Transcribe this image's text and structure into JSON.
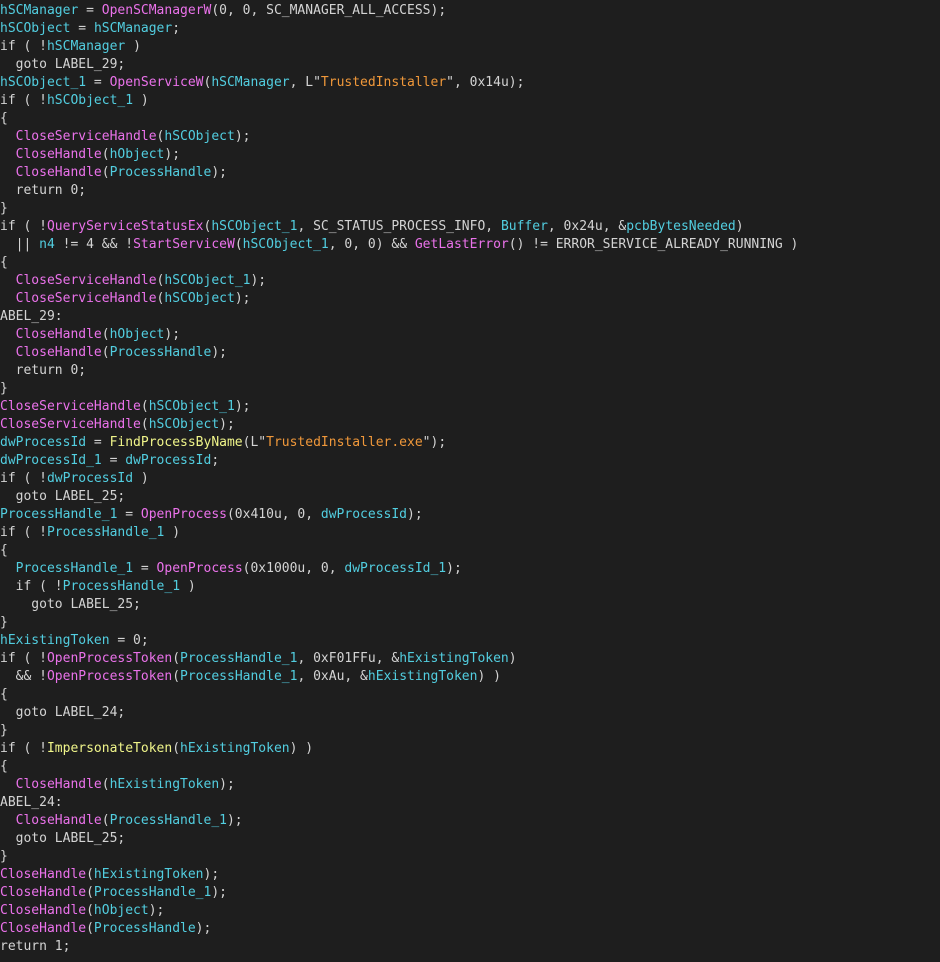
{
  "colors": {
    "background": "#1e1e1e",
    "t": "#d4d4d4",
    "v": "#52cee0",
    "f": "#eb72eb",
    "g": "#f0f58a",
    "s": "#f0983a"
  },
  "code": {
    "lines": [
      [
        [
          "v",
          "hSCManager"
        ],
        [
          "t",
          " = "
        ],
        [
          "f",
          "OpenSCManagerW"
        ],
        [
          "t",
          "(0, 0, SC_MANAGER_ALL_ACCESS);"
        ]
      ],
      [
        [
          "v",
          "hSCObject"
        ],
        [
          "t",
          " = "
        ],
        [
          "v",
          "hSCManager"
        ],
        [
          "t",
          ";"
        ]
      ],
      [
        [
          "t",
          "if ( !"
        ],
        [
          "v",
          "hSCManager"
        ],
        [
          "t",
          " )"
        ]
      ],
      [
        [
          "t",
          "  goto LABEL_29;"
        ]
      ],
      [
        [
          "v",
          "hSCObject_1"
        ],
        [
          "t",
          " = "
        ],
        [
          "f",
          "OpenServiceW"
        ],
        [
          "t",
          "("
        ],
        [
          "v",
          "hSCManager"
        ],
        [
          "t",
          ", L\""
        ],
        [
          "s",
          "TrustedInstaller"
        ],
        [
          "t",
          "\", 0x14u);"
        ]
      ],
      [
        [
          "t",
          "if ( !"
        ],
        [
          "v",
          "hSCObject_1"
        ],
        [
          "t",
          " )"
        ]
      ],
      [
        [
          "t",
          "{"
        ]
      ],
      [
        [
          "t",
          "  "
        ],
        [
          "f",
          "CloseServiceHandle"
        ],
        [
          "t",
          "("
        ],
        [
          "v",
          "hSCObject"
        ],
        [
          "t",
          ");"
        ]
      ],
      [
        [
          "t",
          "  "
        ],
        [
          "f",
          "CloseHandle"
        ],
        [
          "t",
          "("
        ],
        [
          "v",
          "hObject"
        ],
        [
          "t",
          ");"
        ]
      ],
      [
        [
          "t",
          "  "
        ],
        [
          "f",
          "CloseHandle"
        ],
        [
          "t",
          "("
        ],
        [
          "v",
          "ProcessHandle"
        ],
        [
          "t",
          ");"
        ]
      ],
      [
        [
          "t",
          "  return 0;"
        ]
      ],
      [
        [
          "t",
          "}"
        ]
      ],
      [
        [
          "t",
          "if ( !"
        ],
        [
          "f",
          "QueryServiceStatusEx"
        ],
        [
          "t",
          "("
        ],
        [
          "v",
          "hSCObject_1"
        ],
        [
          "t",
          ", SC_STATUS_PROCESS_INFO, "
        ],
        [
          "v",
          "Buffer"
        ],
        [
          "t",
          ", 0x24u, &"
        ],
        [
          "v",
          "pcbBytesNeeded"
        ],
        [
          "t",
          ")"
        ]
      ],
      [
        [
          "t",
          "  || "
        ],
        [
          "v",
          "n4"
        ],
        [
          "t",
          " != 4 && !"
        ],
        [
          "f",
          "StartServiceW"
        ],
        [
          "t",
          "("
        ],
        [
          "v",
          "hSCObject_1"
        ],
        [
          "t",
          ", 0, 0) && "
        ],
        [
          "f",
          "GetLastError"
        ],
        [
          "t",
          "() != ERROR_SERVICE_ALREADY_RUNNING )"
        ]
      ],
      [
        [
          "t",
          "{"
        ]
      ],
      [
        [
          "t",
          "  "
        ],
        [
          "f",
          "CloseServiceHandle"
        ],
        [
          "t",
          "("
        ],
        [
          "v",
          "hSCObject_1"
        ],
        [
          "t",
          ");"
        ]
      ],
      [
        [
          "t",
          "  "
        ],
        [
          "f",
          "CloseServiceHandle"
        ],
        [
          "t",
          "("
        ],
        [
          "v",
          "hSCObject"
        ],
        [
          "t",
          ");"
        ]
      ],
      [
        [
          "t",
          "ABEL_29:"
        ]
      ],
      [
        [
          "t",
          "  "
        ],
        [
          "f",
          "CloseHandle"
        ],
        [
          "t",
          "("
        ],
        [
          "v",
          "hObject"
        ],
        [
          "t",
          ");"
        ]
      ],
      [
        [
          "t",
          "  "
        ],
        [
          "f",
          "CloseHandle"
        ],
        [
          "t",
          "("
        ],
        [
          "v",
          "ProcessHandle"
        ],
        [
          "t",
          ");"
        ]
      ],
      [
        [
          "t",
          "  return 0;"
        ]
      ],
      [
        [
          "t",
          "}"
        ]
      ],
      [
        [
          "f",
          "CloseServiceHandle"
        ],
        [
          "t",
          "("
        ],
        [
          "v",
          "hSCObject_1"
        ],
        [
          "t",
          ");"
        ]
      ],
      [
        [
          "f",
          "CloseServiceHandle"
        ],
        [
          "t",
          "("
        ],
        [
          "v",
          "hSCObject"
        ],
        [
          "t",
          ");"
        ]
      ],
      [
        [
          "v",
          "dwProcessId"
        ],
        [
          "t",
          " = "
        ],
        [
          "g",
          "FindProcessByName"
        ],
        [
          "t",
          "(L\""
        ],
        [
          "s",
          "TrustedInstaller.exe"
        ],
        [
          "t",
          "\");"
        ]
      ],
      [
        [
          "v",
          "dwProcessId_1"
        ],
        [
          "t",
          " = "
        ],
        [
          "v",
          "dwProcessId"
        ],
        [
          "t",
          ";"
        ]
      ],
      [
        [
          "t",
          "if ( !"
        ],
        [
          "v",
          "dwProcessId"
        ],
        [
          "t",
          " )"
        ]
      ],
      [
        [
          "t",
          "  goto LABEL_25;"
        ]
      ],
      [
        [
          "v",
          "ProcessHandle_1"
        ],
        [
          "t",
          " = "
        ],
        [
          "f",
          "OpenProcess"
        ],
        [
          "t",
          "(0x410u, 0, "
        ],
        [
          "v",
          "dwProcessId"
        ],
        [
          "t",
          ");"
        ]
      ],
      [
        [
          "t",
          "if ( !"
        ],
        [
          "v",
          "ProcessHandle_1"
        ],
        [
          "t",
          " )"
        ]
      ],
      [
        [
          "t",
          "{"
        ]
      ],
      [
        [
          "t",
          "  "
        ],
        [
          "v",
          "ProcessHandle_1"
        ],
        [
          "t",
          " = "
        ],
        [
          "f",
          "OpenProcess"
        ],
        [
          "t",
          "(0x1000u, 0, "
        ],
        [
          "v",
          "dwProcessId_1"
        ],
        [
          "t",
          ");"
        ]
      ],
      [
        [
          "t",
          "  if ( !"
        ],
        [
          "v",
          "ProcessHandle_1"
        ],
        [
          "t",
          " )"
        ]
      ],
      [
        [
          "t",
          "    goto LABEL_25;"
        ]
      ],
      [
        [
          "t",
          "}"
        ]
      ],
      [
        [
          "v",
          "hExistingToken"
        ],
        [
          "t",
          " = 0;"
        ]
      ],
      [
        [
          "t",
          "if ( !"
        ],
        [
          "f",
          "OpenProcessToken"
        ],
        [
          "t",
          "("
        ],
        [
          "v",
          "ProcessHandle_1"
        ],
        [
          "t",
          ", 0xF01FFu, &"
        ],
        [
          "v",
          "hExistingToken"
        ],
        [
          "t",
          ")"
        ]
      ],
      [
        [
          "t",
          "  && !"
        ],
        [
          "f",
          "OpenProcessToken"
        ],
        [
          "t",
          "("
        ],
        [
          "v",
          "ProcessHandle_1"
        ],
        [
          "t",
          ", 0xAu, &"
        ],
        [
          "v",
          "hExistingToken"
        ],
        [
          "t",
          ") )"
        ]
      ],
      [
        [
          "t",
          "{"
        ]
      ],
      [
        [
          "t",
          "  goto LABEL_24;"
        ]
      ],
      [
        [
          "t",
          "}"
        ]
      ],
      [
        [
          "t",
          "if ( !"
        ],
        [
          "g",
          "ImpersonateToken"
        ],
        [
          "t",
          "("
        ],
        [
          "v",
          "hExistingToken"
        ],
        [
          "t",
          ") )"
        ]
      ],
      [
        [
          "t",
          "{"
        ]
      ],
      [
        [
          "t",
          "  "
        ],
        [
          "f",
          "CloseHandle"
        ],
        [
          "t",
          "("
        ],
        [
          "v",
          "hExistingToken"
        ],
        [
          "t",
          ");"
        ]
      ],
      [
        [
          "t",
          "ABEL_24:"
        ]
      ],
      [
        [
          "t",
          "  "
        ],
        [
          "f",
          "CloseHandle"
        ],
        [
          "t",
          "("
        ],
        [
          "v",
          "ProcessHandle_1"
        ],
        [
          "t",
          ");"
        ]
      ],
      [
        [
          "t",
          "  goto LABEL_25;"
        ]
      ],
      [
        [
          "t",
          "}"
        ]
      ],
      [
        [
          "f",
          "CloseHandle"
        ],
        [
          "t",
          "("
        ],
        [
          "v",
          "hExistingToken"
        ],
        [
          "t",
          ");"
        ]
      ],
      [
        [
          "f",
          "CloseHandle"
        ],
        [
          "t",
          "("
        ],
        [
          "v",
          "ProcessHandle_1"
        ],
        [
          "t",
          ");"
        ]
      ],
      [
        [
          "f",
          "CloseHandle"
        ],
        [
          "t",
          "("
        ],
        [
          "v",
          "hObject"
        ],
        [
          "t",
          ");"
        ]
      ],
      [
        [
          "f",
          "CloseHandle"
        ],
        [
          "t",
          "("
        ],
        [
          "v",
          "ProcessHandle"
        ],
        [
          "t",
          ");"
        ]
      ],
      [
        [
          "t",
          "return 1;"
        ]
      ]
    ]
  }
}
